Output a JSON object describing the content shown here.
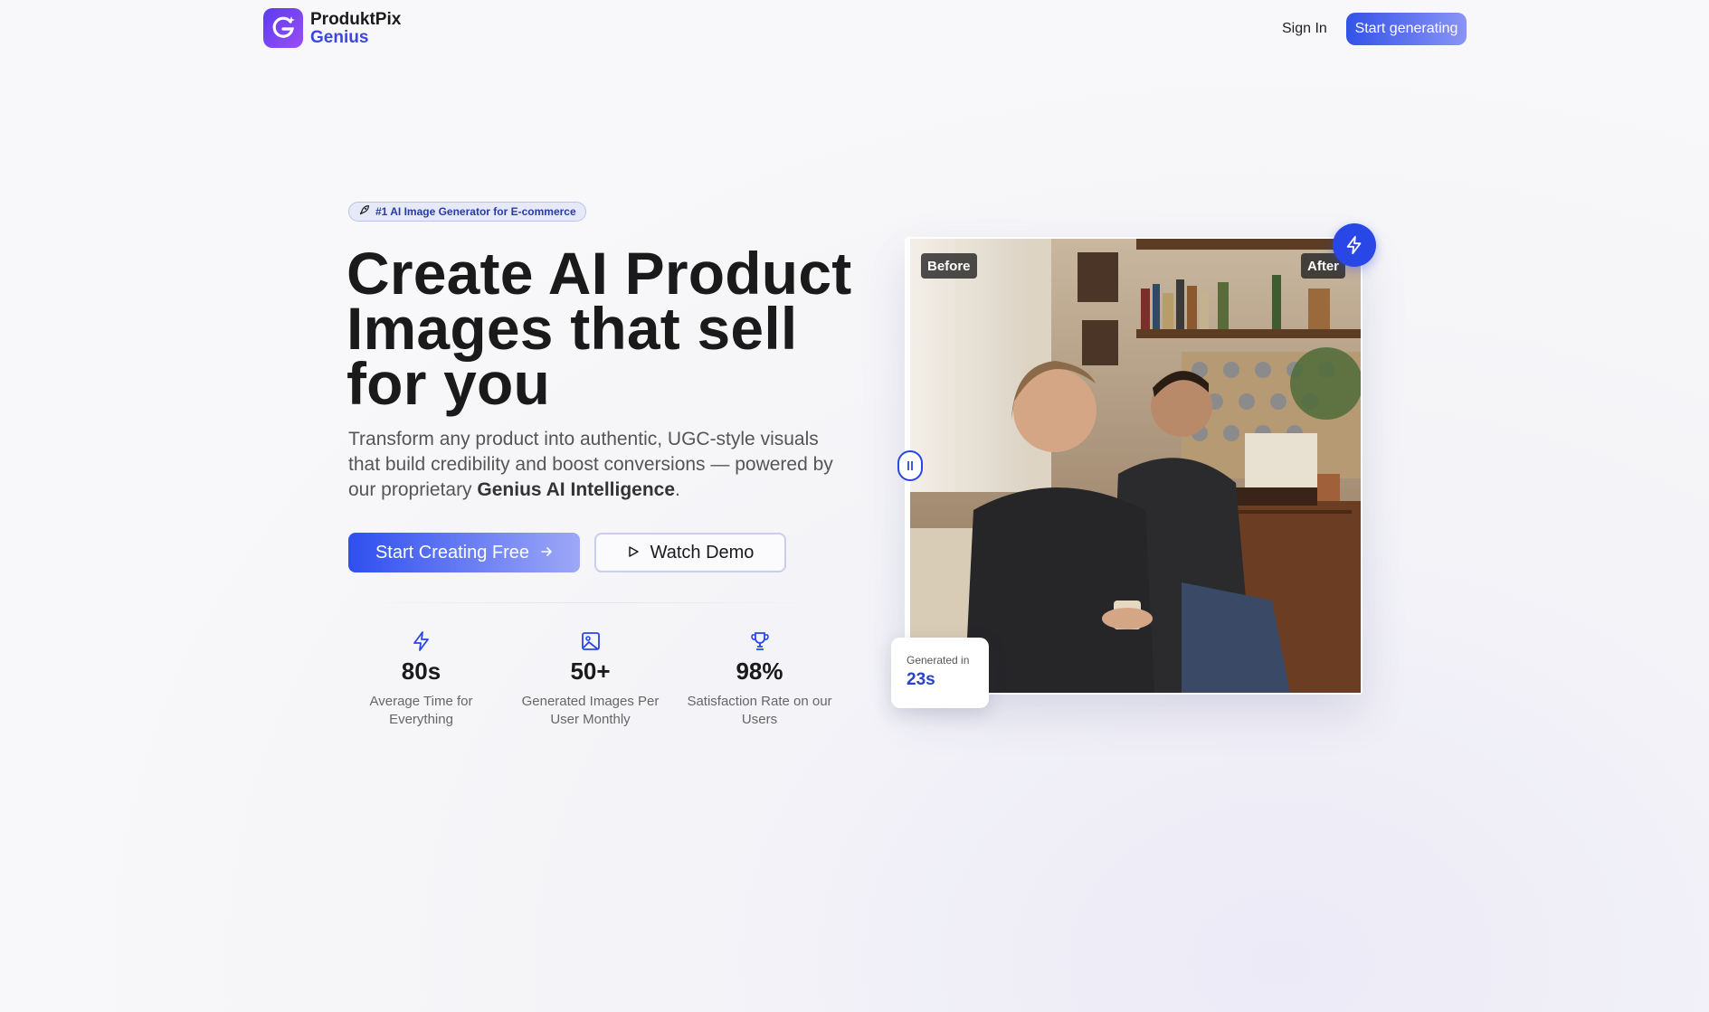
{
  "brand": {
    "name_line1": "ProduktPix",
    "name_line2": "Genius"
  },
  "nav": {
    "sign_in": "Sign In",
    "start_generating": "Start generating"
  },
  "hero": {
    "badge": "#1 AI Image Generator for E-commerce",
    "title": "Create AI Product Images that sell for you",
    "subtitle_pre": "Transform any product into authentic, UGC-style visuals that build credibility and boost conversions — powered by our proprietary ",
    "subtitle_bold": "Genius AI Intelligence",
    "subtitle_post": ".",
    "primary_cta": "Start Creating Free",
    "secondary_cta": "Watch Demo"
  },
  "stats": [
    {
      "icon": "bolt-icon",
      "value": "80s",
      "label": "Average Time for Everything"
    },
    {
      "icon": "image-icon",
      "value": "50+",
      "label": "Generated Images Per User Monthly"
    },
    {
      "icon": "trophy-icon",
      "value": "98%",
      "label": "Satisfaction Rate on our Users"
    }
  ],
  "preview": {
    "before_label": "Before",
    "after_label": "After",
    "generated_label": "Generated in",
    "generated_value": "23s"
  },
  "colors": {
    "accent": "#2946e6",
    "brand_gradient_start": "#5b3cf0",
    "brand_gradient_end": "#9a4df5"
  }
}
